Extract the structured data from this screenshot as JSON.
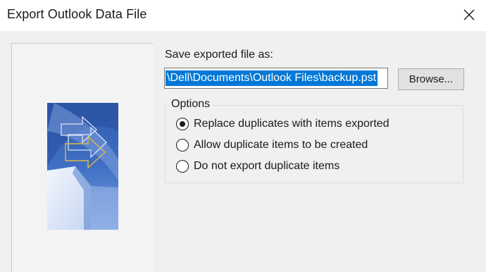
{
  "window": {
    "title": "Export Outlook Data File",
    "close_icon": "close-icon"
  },
  "save": {
    "label": "Save exported file as:",
    "path_value": "\\Dell\\Documents\\Outlook Files\\backup.pst",
    "browse_label": "Browse..."
  },
  "options": {
    "legend": "Options",
    "items": [
      {
        "label": "Replace duplicates with items exported",
        "checked": true
      },
      {
        "label": "Allow duplicate items to be created",
        "checked": false
      },
      {
        "label": "Do not export duplicate items",
        "checked": false
      }
    ]
  },
  "art": {
    "icon": "wizard-arrow-graphic",
    "colors": {
      "deep": "#2a55a8",
      "mid": "#4d7fd0",
      "light": "#a9c3ee",
      "pale": "#dfe8f7"
    }
  },
  "colors": {
    "selection": "#0078d7",
    "titlebar": "#ffffff",
    "dialog_bg": "#f0f0f0"
  }
}
